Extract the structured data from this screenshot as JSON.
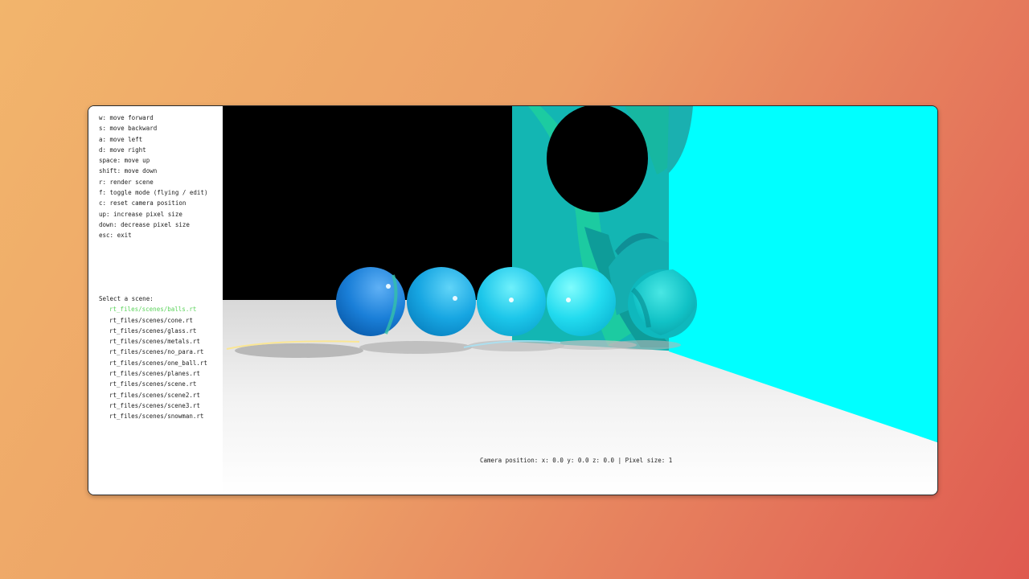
{
  "controls": [
    "w: move forward",
    "s: move backward",
    "a: move left",
    "d: move right",
    "space: move up",
    "shift: move down",
    "r: render scene",
    "f: toggle mode (flying / edit)",
    "c: reset camera position",
    "up: increase pixel size",
    "down: decrease pixel size",
    "esc: exit"
  ],
  "scene_selector": {
    "title": "Select a scene:",
    "items": [
      "rt_files/scenes/balls.rt",
      "rt_files/scenes/cone.rt",
      "rt_files/scenes/glass.rt",
      "rt_files/scenes/metals.rt",
      "rt_files/scenes/no_para.rt",
      "rt_files/scenes/one_ball.rt",
      "rt_files/scenes/planes.rt",
      "rt_files/scenes/scene.rt",
      "rt_files/scenes/scene2.rt",
      "rt_files/scenes/scene3.rt",
      "rt_files/scenes/snowman.rt"
    ],
    "selected_index": 0
  },
  "status_bar": {
    "text": "Camera position: x: 0.0 y: 0.0 z: 0.0 | Pixel size: 1"
  },
  "colors": {
    "selected_scene": "#5bd35b",
    "wall": "#00ffff",
    "background": "#000000",
    "floor": "#ffffff"
  }
}
